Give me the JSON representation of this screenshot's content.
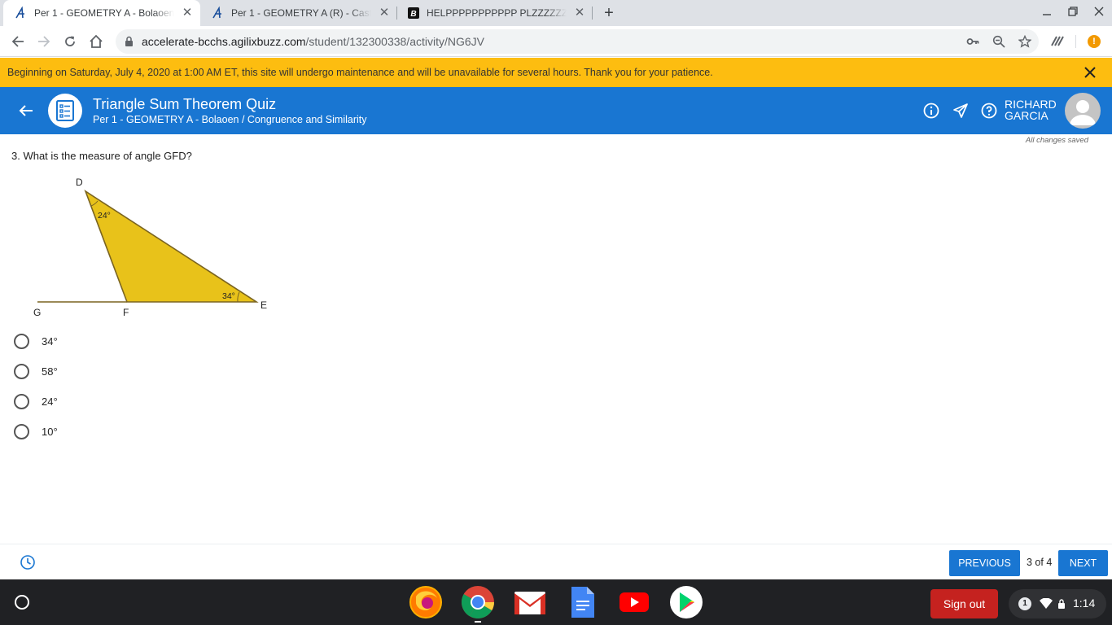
{
  "browser": {
    "tabs": [
      {
        "title": "Per 1 - GEOMETRY A - Bolaoen - Agilix",
        "active": true
      },
      {
        "title": "Per 1 - GEOMETRY A (R) - Castillo",
        "active": false
      },
      {
        "title": "HELPPPPPPPPPPP PLZZZZZZZ",
        "active": false
      }
    ],
    "url_host": "accelerate-bcchs.agilixbuzz.com",
    "url_path": "/student/132300338/activity/NG6JV",
    "profile_badge": "!"
  },
  "banner": {
    "message": "Beginning on Saturday, July 4, 2020 at 1:00 AM ET, this site will undergo maintenance and will be unavailable for several hours. Thank you for your patience."
  },
  "header": {
    "title": "Triangle Sum Theorem Quiz",
    "subtitle": "Per 1 - GEOMETRY A - Bolaoen / Congruence and Similarity",
    "user_first": "RICHARD",
    "user_last": "GARCIA",
    "color": "#1976d2"
  },
  "status": {
    "saved": "All changes saved"
  },
  "question": {
    "text": "3. What is the measure of angle GFD?",
    "figure": {
      "labels": {
        "D": "D",
        "E": "E",
        "F": "F",
        "G": "G"
      },
      "angle_d": "24°",
      "angle_e": "34°",
      "fill": "#e8c21a"
    },
    "choices": [
      "34°",
      "58°",
      "24°",
      "10°"
    ]
  },
  "footer": {
    "previous": "PREVIOUS",
    "next": "NEXT",
    "pager": "3 of 4"
  },
  "shelf": {
    "apps": [
      "firefox-icon",
      "chrome-icon",
      "gmail-icon",
      "docs-icon",
      "youtube-icon",
      "play-store-icon"
    ],
    "sign_out": "Sign out",
    "notification_count": "1",
    "time": "1:14"
  }
}
